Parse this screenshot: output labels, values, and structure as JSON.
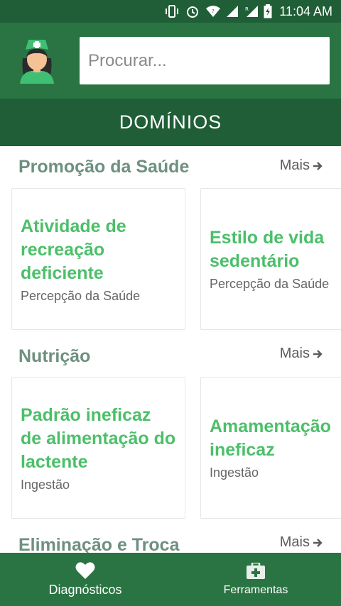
{
  "status": {
    "time": "11:04 AM",
    "icons": [
      "vibrate-icon",
      "alarm-icon",
      "wifi-icon",
      "signal-icon",
      "roaming-signal-icon",
      "battery-charging-icon"
    ]
  },
  "header": {
    "avatar_icon": "nurse-avatar-icon",
    "search_placeholder": "Procurar..."
  },
  "domains_title": "DOMÍNIOS",
  "sections": [
    {
      "title": "Promoção da Saúde",
      "more_label": "Mais",
      "cards": [
        {
          "title": "Atividade de recreação deficiente",
          "subtitle": "Percepção da Saúde"
        },
        {
          "title": "Estilo de vida sedentário",
          "subtitle": "Percepção da Saúde"
        }
      ]
    },
    {
      "title": "Nutrição",
      "more_label": "Mais",
      "cards": [
        {
          "title": "Padrão ineficaz de alimentação do lactente",
          "subtitle": "Ingestão"
        },
        {
          "title": "Amamentação ineficaz",
          "subtitle": "Ingestão"
        }
      ]
    },
    {
      "title": "Eliminação e Troca",
      "more_label": "Mais",
      "cards": []
    }
  ],
  "bottom_nav": [
    {
      "label": "Diagnósticos",
      "icon": "heart-icon"
    },
    {
      "label": "Ferramentas",
      "icon": "medical-kit-icon"
    }
  ],
  "colors": {
    "primary": "#2a7443",
    "primary_dark": "#1f5e36",
    "card_title": "#4cbf6a",
    "section_title": "#6e9080"
  }
}
